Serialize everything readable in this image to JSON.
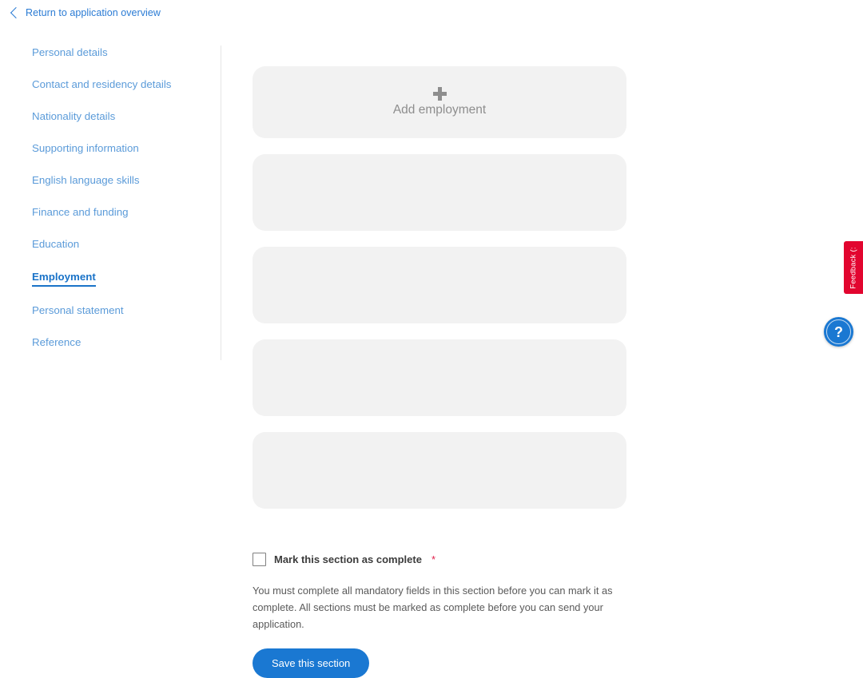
{
  "topbar": {
    "back_label": "Return to application overview"
  },
  "sidebar": {
    "items": [
      {
        "label": "Personal details",
        "active": false
      },
      {
        "label": "Contact and residency details",
        "active": false
      },
      {
        "label": "Nationality details",
        "active": false
      },
      {
        "label": "Supporting information",
        "active": false
      },
      {
        "label": "English language skills",
        "active": false
      },
      {
        "label": "Finance and funding",
        "active": false
      },
      {
        "label": "Education",
        "active": false
      },
      {
        "label": "Employment",
        "active": true
      },
      {
        "label": "Personal statement",
        "active": false
      },
      {
        "label": "Reference",
        "active": false
      }
    ]
  },
  "main": {
    "add_card": {
      "label": "Add employment",
      "icon": "plus-icon"
    },
    "placeholder_card_count": 4
  },
  "complete_section": {
    "checkbox_label": "Mark this section as complete",
    "required_marker": "*",
    "checked": false,
    "help_text": "You must complete all mandatory fields in this section before you can mark it as complete. All sections must be marked as complete before you can send your application.",
    "save_label": "Save this section"
  },
  "widgets": {
    "feedback_label": "Feedback (:",
    "help_label": "?"
  },
  "colors": {
    "link_blue": "#2a7bd4",
    "nav_blue": "#5b9bd9",
    "active_blue": "#1a73c8",
    "button_blue": "#1a78d2",
    "card_grey": "#f2f2f2",
    "feedback_red": "#e2052f",
    "required_red": "#e0204b"
  }
}
